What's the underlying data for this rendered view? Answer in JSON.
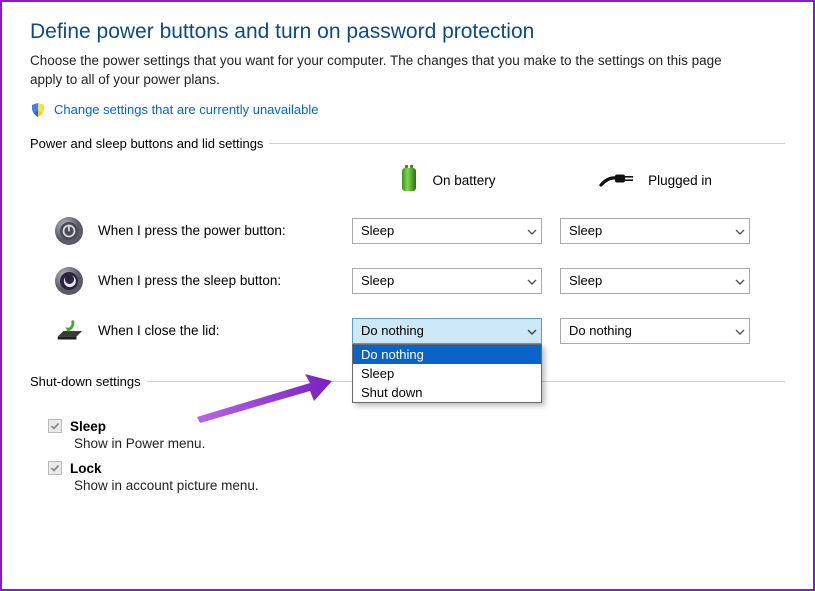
{
  "title": "Define power buttons and turn on password protection",
  "description": "Choose the power settings that you want for your computer. The changes that you make to the settings on this page apply to all of your power plans.",
  "change_link": "Change settings that are currently unavailable",
  "section1_label": "Power and sleep buttons and lid settings",
  "columns": {
    "battery": "On battery",
    "plugged": "Plugged in"
  },
  "rows": {
    "power_button": "When I press the power button:",
    "sleep_button": "When I press the sleep button:",
    "close_lid": "When I close the lid:"
  },
  "values": {
    "power_battery": "Sleep",
    "power_plugged": "Sleep",
    "sleep_battery": "Sleep",
    "sleep_plugged": "Sleep",
    "lid_battery": "Do nothing",
    "lid_plugged": "Do nothing"
  },
  "lid_options": {
    "o0": "Do nothing",
    "o1": "Sleep",
    "o2": "Shut down"
  },
  "section2_label": "Shut-down settings",
  "shutdown": {
    "sleep_label": "Sleep",
    "sleep_sub": "Show in Power menu.",
    "lock_label": "Lock",
    "lock_sub": "Show in account picture menu."
  }
}
